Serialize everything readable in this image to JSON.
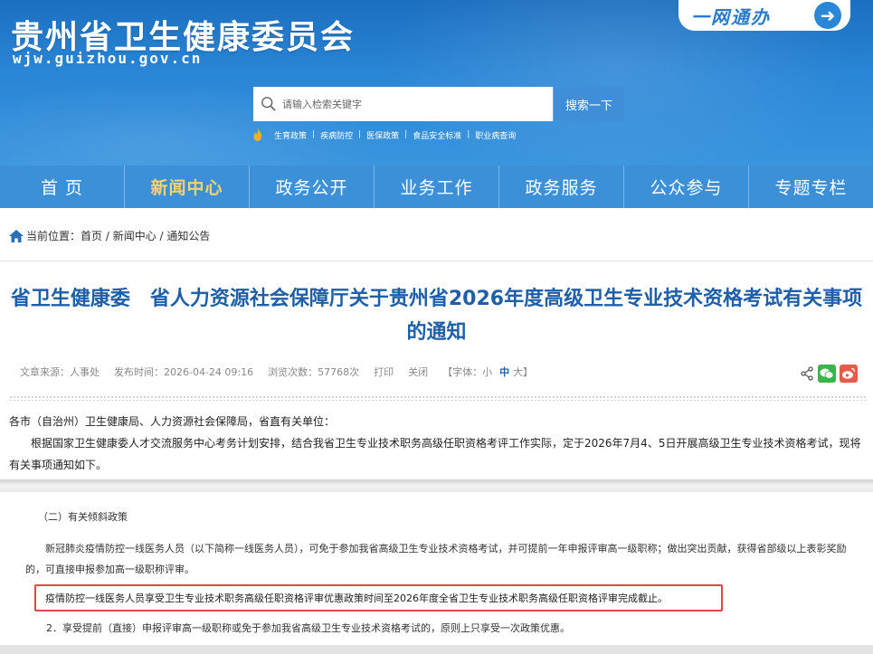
{
  "header": {
    "title": "贵州省卫生健康委员会",
    "domain": "wjw.guizhou.gov.cn",
    "yiwang_label": "一网通办"
  },
  "search": {
    "placeholder": "请输入检索关键字",
    "button_label": "搜索一下",
    "hot_links": [
      "生育政策",
      "疾病防控",
      "医保政策",
      "食品安全标准",
      "职业病查询"
    ]
  },
  "nav": {
    "items": [
      "首 页",
      "新闻中心",
      "政务公开",
      "业务工作",
      "政务服务",
      "公众参与",
      "专题专栏"
    ],
    "active": "新闻中心"
  },
  "breadcrumb": {
    "label": "当前位置：",
    "home": "首页",
    "news": "新闻中心",
    "section": "通知公告",
    "sep": " / "
  },
  "article": {
    "title": "省卫生健康委　省人力资源社会保障厅关于贵州省2026年度高级卫生专业技术资格考试有关事项的通知",
    "meta": {
      "source": "文章来源：人事处",
      "published": "发布时间：2026-04-24 09:16",
      "views": "浏览次数：57768次",
      "print": "打印",
      "close": "关闭",
      "font_prefix": "【字体：",
      "font_small": "小",
      "font_medium": "中",
      "font_large": "大",
      "font_suffix": "】"
    },
    "salutation": "各市（自治州）卫生健康局、人力资源社会保障局，省直有关单位：",
    "intro": "根据国家卫生健康委人才交流服务中心考务计划安排，结合我省卫生专业技术职务高级任职资格考评工作实际，定于2026年7月4、5日开展高级卫生专业技术资格考试，现将有关事项通知如下。",
    "section2_heading": "（二）有关倾斜政策",
    "section2_para": "新冠肺炎疫情防控一线医务人员（以下简称一线医务人员），可免于参加我省高级卫生专业技术资格考试，并可提前一年申报评审高一级职称；做出突出贡献，获得省部级以上表彰奖励的，可直接申报参加高一级职称评审。",
    "highlight": "疫情防控一线医务人员享受卫生专业技术职务高级任职资格评审优惠政策时间至2026年度全省卫生专业技术职务高级任职资格评审完成截止。",
    "item2": "2．享受提前（直接）申报评审高一级职称或免于参加我省高级卫生专业技术资格考试的，原则上只享受一次政策优惠。"
  },
  "colors": {
    "header_blue": "#2a86d6",
    "nav_blue": "#3b90d8",
    "title_blue": "#1f5fa8",
    "active_nav": "#ffd26a",
    "highlight_border": "#e04848"
  }
}
